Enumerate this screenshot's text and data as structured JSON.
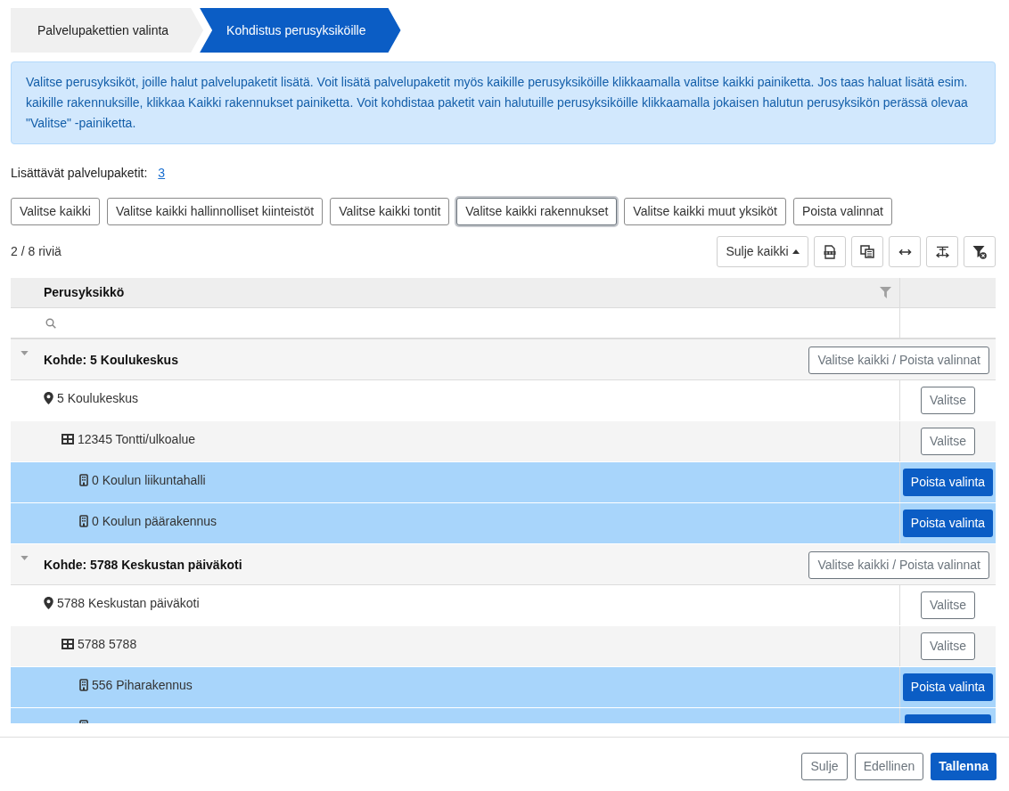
{
  "steps": [
    {
      "label": "Palvelupakettien valinta",
      "selected": false
    },
    {
      "label": "Kohdistus perusyksiköille",
      "selected": true
    }
  ],
  "info": "Valitse perusyksiköt, joille halut palvelupaketit lisätä. Voit lisätä palvelupaketit myös kaikille perusyksiköille klikkaamalla valitse kaikki painiketta. Jos taas haluat lisätä esim. kaikille rakennuksille, klikkaa Kaikki rakennukset painiketta. Voit kohdistaa paketit vain halutuille perusyksiköille klikkaamalla jokaisen halutun perusyksikön perässä olevaa \"Valitse\" -painiketta.",
  "packages": {
    "label": "Lisättävät palvelupaketit:",
    "count": "3"
  },
  "select_buttons": [
    {
      "label": "Valitse kaikki",
      "focused": false
    },
    {
      "label": "Valitse kaikki hallinnolliset kiinteistöt",
      "focused": false
    },
    {
      "label": "Valitse kaikki tontit",
      "focused": false
    },
    {
      "label": "Valitse kaikki rakennukset",
      "focused": true
    },
    {
      "label": "Valitse kaikki muut yksiköt",
      "focused": false
    },
    {
      "label": "Poista valinnat",
      "focused": false
    }
  ],
  "table_toolbar": {
    "row_count": "2 / 8 riviä",
    "collapse_button": "Sulje kaikki"
  },
  "table": {
    "columns": [
      {
        "label": "Perusyksikkö"
      }
    ],
    "groups": [
      {
        "title": "Kohde: 5 Koulukeskus",
        "expanded": true,
        "button": "Valitse kaikki / Poista valinnat",
        "children": [
          {
            "kind": "location",
            "label": "5 Koulukeskus",
            "selected": false,
            "button": "Valitse",
            "children": [
              {
                "kind": "plot",
                "label": "12345 Tontti/ulkoalue",
                "selected": false,
                "button": "Valitse",
                "children": [
                  {
                    "kind": "building",
                    "label": "0 Koulun liikuntahalli",
                    "selected": true,
                    "button": "Poista valinta"
                  },
                  {
                    "kind": "building",
                    "label": "0 Koulun päärakennus",
                    "selected": true,
                    "button": "Poista valinta"
                  }
                ]
              }
            ]
          }
        ]
      },
      {
        "title": "Kohde: 5788 Keskustan päiväkoti",
        "expanded": true,
        "button": "Valitse kaikki / Poista valinnat",
        "children": [
          {
            "kind": "location",
            "label": "5788 Keskustan päiväkoti",
            "selected": false,
            "button": "Valitse",
            "children": [
              {
                "kind": "plot",
                "label": "5788 5788",
                "selected": false,
                "button": "Valitse",
                "children": [
                  {
                    "kind": "building",
                    "label": "556 Piharakennus",
                    "selected": true,
                    "button": "Poista valinta"
                  },
                  {
                    "kind": "building",
                    "selected": true
                  }
                ]
              }
            ]
          }
        ]
      }
    ]
  },
  "footer_buttons": [
    {
      "label": "Sulje",
      "kind": "outline"
    },
    {
      "label": "Edellinen",
      "kind": "outline"
    },
    {
      "label": "Tallenna",
      "kind": "primary"
    }
  ]
}
